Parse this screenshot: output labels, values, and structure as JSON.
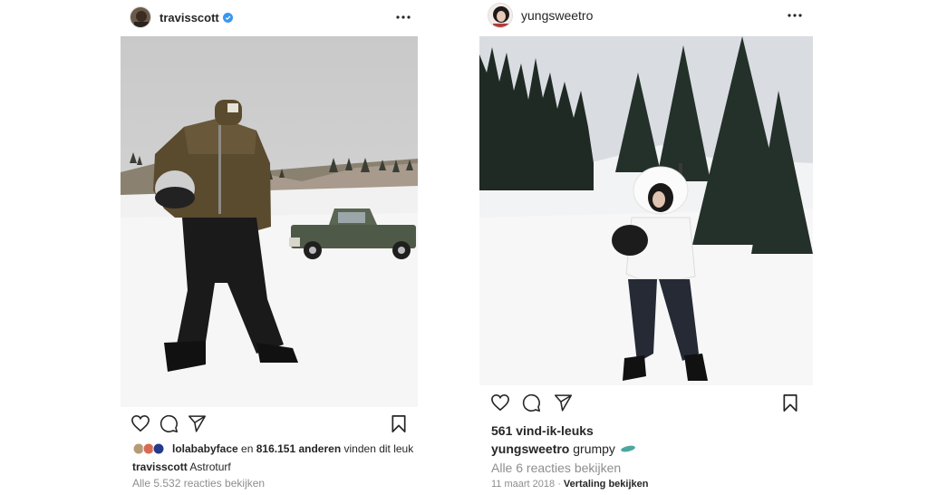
{
  "post1": {
    "username": "travisscott",
    "likes_user": "lolababyface",
    "likes_mid": "en",
    "likes_count": "816.151 anderen",
    "likes_tail": "vinden dit leuk",
    "caption_user": "travisscott",
    "caption_text": "Astroturf",
    "comments_link": "Alle 5.532 reacties bekijken"
  },
  "post2": {
    "username": "yungsweetro",
    "likes": "561 vind-ik-leuks",
    "caption_user": "yungsweetro",
    "caption_text": "grumpy",
    "comments_link": "Alle 6 reacties bekijken",
    "date": "11 maart 2018",
    "dot": "·",
    "translate": "Vertaling bekijken"
  },
  "icons": [
    "verified-icon",
    "more-options-icon",
    "heart-icon",
    "comment-icon",
    "share-icon",
    "bookmark-icon",
    "snowboard-emoji-icon"
  ],
  "colors": {
    "text": "#262626",
    "muted": "#8e8e8e",
    "verified": "#3897f0"
  }
}
